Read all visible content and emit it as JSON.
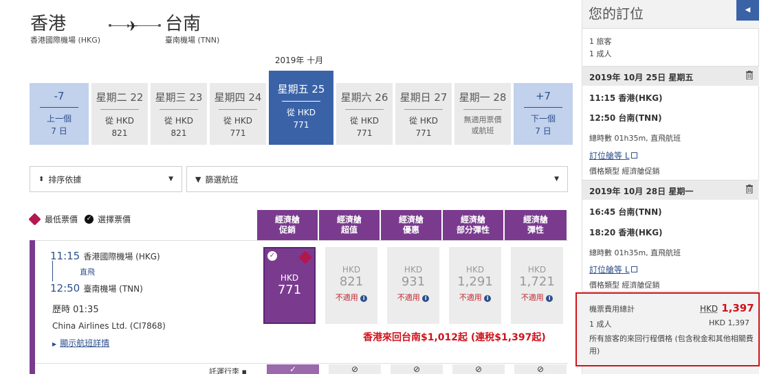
{
  "route": {
    "from_city": "香港",
    "from_airport": "香港國際機場 (HKG)",
    "to_city": "台南",
    "to_airport": "臺南機場 (TNN)"
  },
  "month_label": "2019年 十月",
  "date_strip": [
    {
      "title": "-7",
      "line1": "上一個",
      "line2": "7 日",
      "kind": "nav"
    },
    {
      "title": "星期二 22",
      "line1": "從 HKD",
      "line2": "821",
      "kind": "day"
    },
    {
      "title": "星期三 23",
      "line1": "從 HKD",
      "line2": "821",
      "kind": "day"
    },
    {
      "title": "星期四 24",
      "line1": "從 HKD",
      "line2": "771",
      "kind": "day"
    },
    {
      "title": "星期五 25",
      "line1": "從 HKD",
      "line2": "771",
      "kind": "sel"
    },
    {
      "title": "星期六 26",
      "line1": "從 HKD",
      "line2": "771",
      "kind": "day"
    },
    {
      "title": "星期日 27",
      "line1": "從 HKD",
      "line2": "771",
      "kind": "day"
    },
    {
      "title": "星期一 28",
      "line1": "無適用票價",
      "line2": "或航班",
      "kind": "na"
    },
    {
      "title": "+7",
      "line1": "下一個",
      "line2": "7 日",
      "kind": "nav"
    }
  ],
  "sort_label": "排序依據",
  "filter_label": "篩選航班",
  "legend": {
    "lowest": "最低票價",
    "selected": "選擇票價"
  },
  "fare_columns": [
    {
      "l1": "經濟艙",
      "l2": "促銷"
    },
    {
      "l1": "經濟艙",
      "l2": "超值"
    },
    {
      "l1": "經濟艙",
      "l2": "優惠"
    },
    {
      "l1": "經濟艙",
      "l2": "部分彈性"
    },
    {
      "l1": "經濟艙",
      "l2": "彈性"
    }
  ],
  "flight": {
    "dep_time": "11:15",
    "dep_place": "香港國際機場 (HKG)",
    "direct": "直飛",
    "arr_time": "12:50",
    "arr_place": "臺南機場 (TNN)",
    "duration": "歷時 01:35",
    "carrier": "China Airlines Ltd. (CI7868)",
    "details_link": "顯示航班詳情"
  },
  "fares": [
    {
      "cur": "HKD",
      "amt": "771",
      "status": ""
    },
    {
      "cur": "HKD",
      "amt": "821",
      "status": "不適用"
    },
    {
      "cur": "HKD",
      "amt": "931",
      "status": "不適用"
    },
    {
      "cur": "HKD",
      "amt": "1,291",
      "status": "不適用"
    },
    {
      "cur": "HKD",
      "amt": "1,721",
      "status": "不適用"
    }
  ],
  "promo_text": "香港來回台南$1,012起 (連稅$1,397起)",
  "baggage_label": "託運行李",
  "sidebar": {
    "title": "您的訂位",
    "pax_count": "1 旅客",
    "pax_type": "1 成人",
    "legs": [
      {
        "date": "2019年 10月 25日 星期五",
        "dep": "11:15 香港(HKG)",
        "arr": "12:50 台南(TNN)",
        "summary": "總時數 01h35m, 直飛航班",
        "class_link": "訂位艙等 L",
        "fare_type": "價格類型 經濟艙促銷"
      },
      {
        "date": "2019年 10月 28日 星期一",
        "dep": "16:45 台南(TNN)",
        "arr": "18:20 香港(HKG)",
        "summary": "總時數 01h35m, 直飛航班",
        "class_link": "訂位艙等 L",
        "fare_type": "價格類型 經濟艙促銷"
      }
    ],
    "total_label": "機票費用總計",
    "total_cur": "HKD",
    "total_amt": "1,397",
    "adult_label": "1 成人",
    "adult_amt": "HKD 1,397",
    "note": "所有旅客的來回行程價格 (包含稅金和其他相關費用)"
  },
  "colors": {
    "brand_blue": "#3a62a7",
    "fare_purple": "#7a3b8f",
    "alert_red": "#d0121b"
  }
}
